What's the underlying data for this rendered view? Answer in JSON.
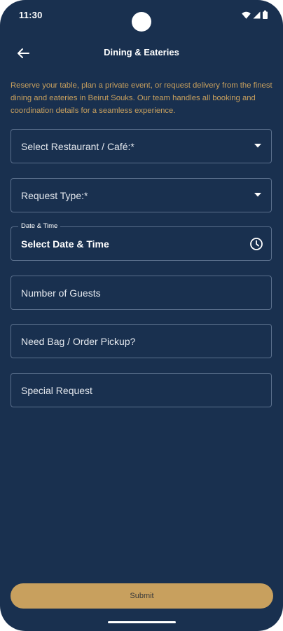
{
  "status_bar": {
    "time": "11:30",
    "icons": [
      "wifi-icon",
      "signal-icon",
      "battery-icon"
    ]
  },
  "app_bar": {
    "title": "Dining & Eateries",
    "back_icon": "arrow-left-icon"
  },
  "intro_text": "Reserve your table, plan a private event, or request delivery from the finest dining and eateries in Beirut Souks. Our team handles all booking and coordination details for a seamless experience.",
  "form": {
    "restaurant": {
      "placeholder": "Select Restaurant / Café:*",
      "icon": "dropdown-arrow-icon"
    },
    "request_type": {
      "placeholder": "Request Type:*",
      "icon": "dropdown-arrow-icon"
    },
    "date_time": {
      "label": "Date & Time",
      "value": "Select Date & Time",
      "icon": "clock-icon"
    },
    "guests": {
      "placeholder": "Number of Guests"
    },
    "pickup": {
      "placeholder": "Need Bag / Order Pickup?"
    },
    "special_request": {
      "placeholder": "Special Request"
    }
  },
  "submit_label": "Submit",
  "colors": {
    "background": "#19304f",
    "accent": "#c8a05e",
    "field_border": "#5a6f8c",
    "text": "#ffffff"
  }
}
